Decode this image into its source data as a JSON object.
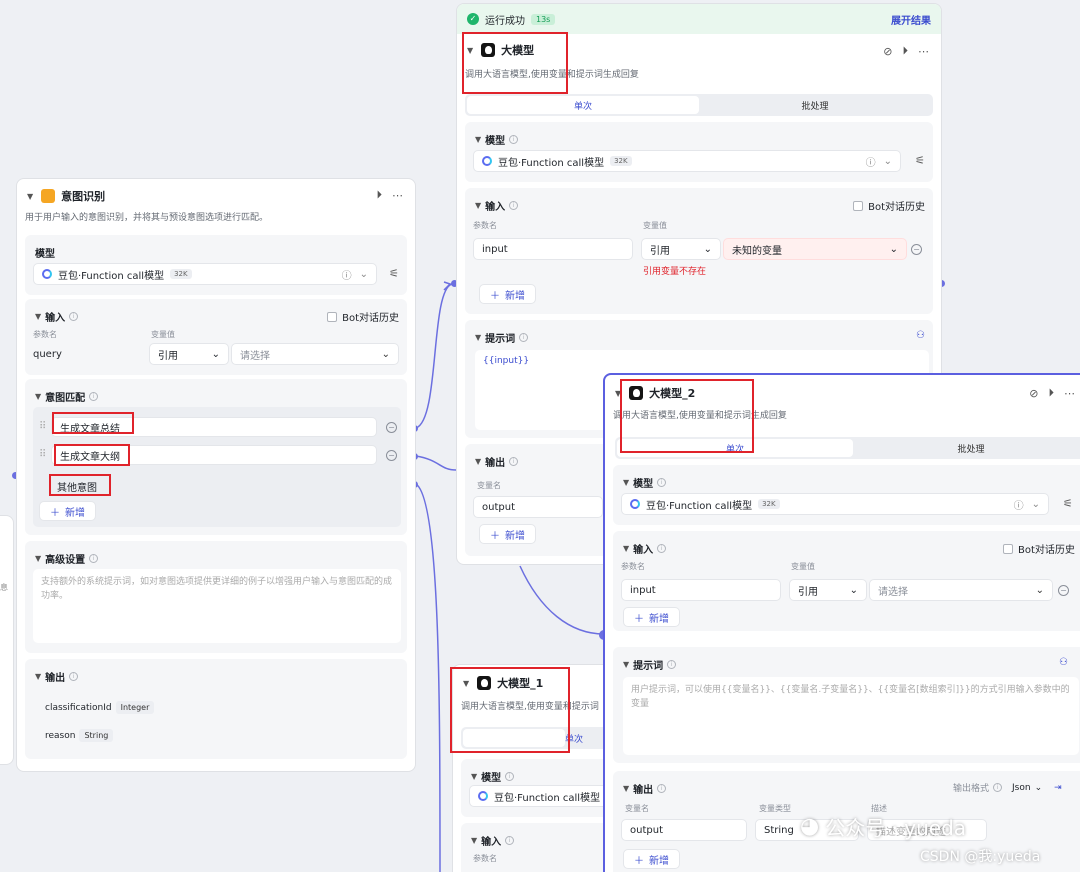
{
  "intent_node": {
    "title": "意图识别",
    "desc": "用于用户输入的意图识别，并将其与预设意图选项进行匹配。",
    "model_label": "模型",
    "model_name": "豆包·Function call模型",
    "model_badge": "32K",
    "input_label": "输入",
    "bot_history": "Bot对话历史",
    "param_col": "参数名",
    "value_col": "变量值",
    "param_name": "query",
    "ref": "引用",
    "placeholder": "请选择",
    "match_label": "意图匹配",
    "intents": [
      "生成文章总结",
      "生成文章大纲"
    ],
    "other": "其他意图",
    "add": "新增",
    "advanced_label": "高级设置",
    "advanced_placeholder": "支持额外的系统提示词，如对意图选项提供更详细的例子以增强用户输入与意图匹配的成功率。",
    "output_label": "输出",
    "outputs": [
      {
        "name": "classificationId",
        "type": "Integer"
      },
      {
        "name": "reason",
        "type": "String"
      }
    ]
  },
  "llm_node": {
    "status": "运行成功",
    "time": "13s",
    "expand": "展开结果",
    "title": "大模型",
    "desc": "调用大语言模型,使用变量和提示词生成回复",
    "tab_single": "单次",
    "tab_batch": "批处理",
    "model_label": "模型",
    "model_name": "豆包·Function call模型",
    "model_badge": "32K",
    "input_label": "输入",
    "bot_history": "Bot对话历史",
    "param_col": "参数名",
    "value_col": "变量值",
    "param_name": "input",
    "ref": "引用",
    "unknown_var": "未知的变量",
    "error": "引用变量不存在",
    "add": "新增",
    "prompt_label": "提示词",
    "prompt_text": "{{input}}",
    "output_label": "输出",
    "var_col": "变量名",
    "output_name": "output"
  },
  "llm2_node": {
    "title": "大模型_2",
    "desc": "调用大语言模型,使用变量和提示词生成回复",
    "tab_single": "单次",
    "tab_batch": "批处理",
    "model_label": "模型",
    "model_name": "豆包·Function call模型",
    "model_badge": "32K",
    "input_label": "输入",
    "bot_history": "Bot对话历史",
    "param_col": "参数名",
    "value_col": "变量值",
    "param_name": "input",
    "ref": "引用",
    "placeholder": "请选择",
    "add": "新增",
    "prompt_label": "提示词",
    "prompt_placeholder": "用户提示词，可以使用{{变量名}}、{{变量名.子变量名}}、{{变量名[数组索引]}}的方式引用输入参数中的变量",
    "output_label": "输出",
    "output_format_label": "输出格式",
    "output_format": "Json",
    "var_col": "变量名",
    "type_col": "变量类型",
    "desc_col": "描述",
    "output_name": "output",
    "output_type": "String",
    "output_desc": "描述变量的用途"
  },
  "llm1_node": {
    "title": "大模型_1",
    "desc": "调用大语言模型,使用变量和提示词",
    "tab_single": "单次",
    "model_label": "模型",
    "model_name": "豆包·Function call模型",
    "input_label": "输入",
    "param_col": "参数名"
  },
  "watermark": {
    "wechat": "公众号 · yueda",
    "csdn": "CSDN @我:yueda"
  }
}
